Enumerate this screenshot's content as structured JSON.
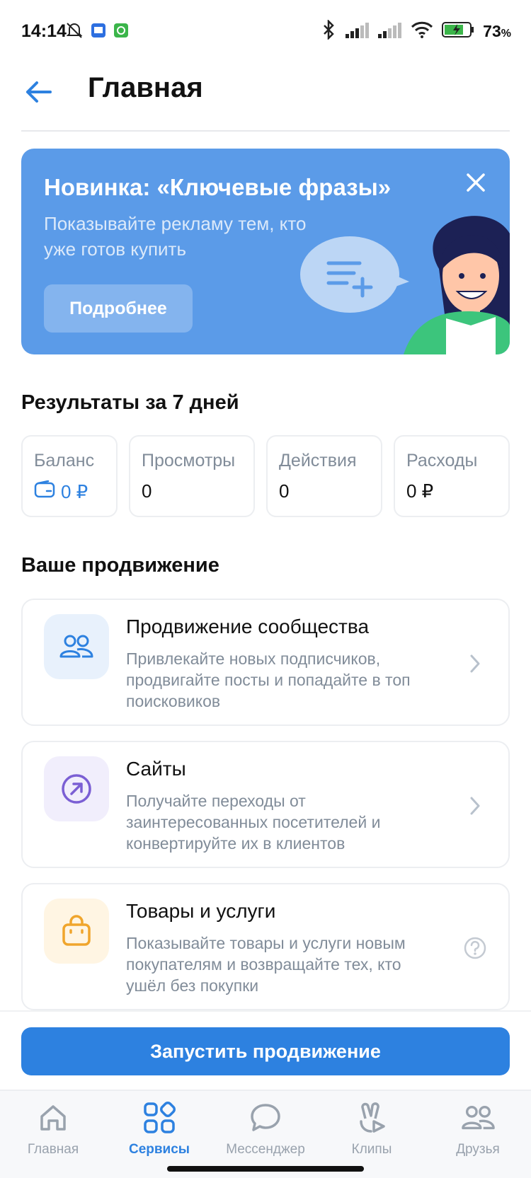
{
  "status_bar": {
    "time": "14:14",
    "battery": "73",
    "battery_unit": "%"
  },
  "header": {
    "title": "Главная"
  },
  "banner": {
    "title": "Новинка: «Ключевые фразы»",
    "subtitle": "Показывайте рекламу тем, кто уже готов купить",
    "button": "Подробнее"
  },
  "results": {
    "title": "Результаты за 7 дней",
    "stats": [
      {
        "label": "Баланс",
        "value": "0 ₽"
      },
      {
        "label": "Просмотры",
        "value": "0"
      },
      {
        "label": "Действия",
        "value": "0"
      },
      {
        "label": "Расходы",
        "value": "0 ₽"
      }
    ]
  },
  "promotion": {
    "title": "Ваше продвижение",
    "cards": [
      {
        "title": "Продвижение сообщества",
        "description": "Привлекайте новых подписчиков, продвигайте посты и попадайте в топ поисковиков",
        "icon": "users-icon",
        "right": "chevron-right-icon"
      },
      {
        "title": "Сайты",
        "description": "Получайте переходы от заинтересованных посетителей и конвертируйте их в клиентов",
        "icon": "arrow-up-right-circle-icon",
        "right": "chevron-right-icon"
      },
      {
        "title": "Товары и услуги",
        "description": "Показывайте товары и услуги новым покупателям и возвращайте тех, кто ушёл без покупки",
        "icon": "shopping-bag-icon",
        "right": "help-icon"
      }
    ]
  },
  "cta": {
    "label": "Запустить продвижение"
  },
  "tabbar": {
    "items": [
      {
        "label": "Главная",
        "icon": "home-icon",
        "active": false
      },
      {
        "label": "Сервисы",
        "icon": "services-icon",
        "active": true
      },
      {
        "label": "Мессенджер",
        "icon": "message-icon",
        "active": false
      },
      {
        "label": "Клипы",
        "icon": "clips-icon",
        "active": false
      },
      {
        "label": "Друзья",
        "icon": "friends-icon",
        "active": false
      }
    ]
  },
  "colors": {
    "accent": "#2d81e0",
    "banner": "#5b9be8",
    "secondary_text": "#818c99"
  }
}
